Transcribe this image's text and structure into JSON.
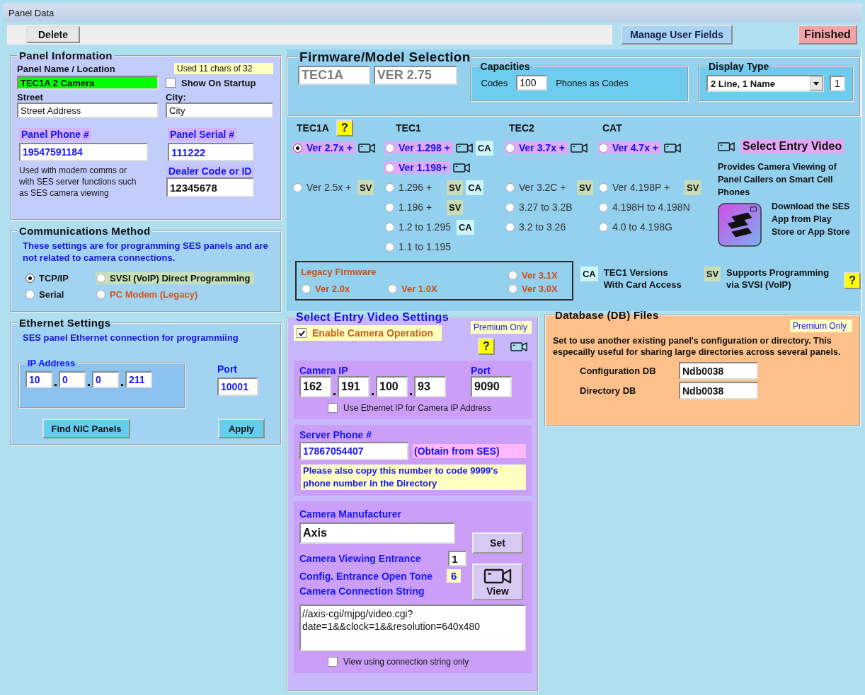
{
  "window": {
    "title": "Panel Data"
  },
  "toolbar": {
    "delete_button": "Delete",
    "manage_button": "Manage User Fields",
    "finished_button": "Finished"
  },
  "panel_info": {
    "title": "Panel Information",
    "name_label": "Panel Name / Location",
    "char_count": "Used 11 chars of 32",
    "name_value": "TEC1A 2 Camera",
    "show_on_startup": {
      "label": "Show On Startup",
      "checked": false
    },
    "street_label": "Street",
    "city_label": "City:",
    "street_value": "Street Address",
    "city_value": "City",
    "phone_label": "Panel Phone #",
    "serial_label": "Panel Serial #",
    "phone_value": "19547591184",
    "serial_value": "111222",
    "phone_note": "Used with modem comms or with SES server functions such as SES camera viewing",
    "dealer_label": "Dealer Code or ID",
    "dealer_value": "12345678"
  },
  "comms": {
    "title": "Communications Method",
    "note": "These settings are for programming SES panels and are not related to camera connections.",
    "options": [
      {
        "label": "TCP/IP",
        "selected": true,
        "kind": "plain"
      },
      {
        "label": "SVSI (VoIP) Direct Programming",
        "selected": false,
        "kind": "voip"
      },
      {
        "label": "Serial",
        "selected": false,
        "kind": "plain"
      },
      {
        "label": "PC Modem (Legacy)",
        "selected": false,
        "kind": "legacy"
      }
    ]
  },
  "ethernet": {
    "title": "Ethernet Settings",
    "note": "SES panel Ethernet connection for programmiing",
    "ip_title": "IP Address",
    "ip": [
      "10",
      "0",
      "0",
      "211"
    ],
    "port_label": "Port",
    "port": "10001",
    "find_button": "Find NIC Panels",
    "apply_button": "Apply"
  },
  "firmware": {
    "title": "Firmware/Model Selection",
    "model": "TEC1A",
    "version": "VER 2.75",
    "capacities": {
      "title": "Capacities",
      "codes_label": "Codes",
      "codes": "100",
      "phones_label": "Phones as Codes"
    },
    "display": {
      "title": "Display Type",
      "value": "2 Line, 1 Name",
      "lines": "1"
    },
    "headings": [
      {
        "label": "TEC1A",
        "help": "?"
      },
      {
        "label": "TEC1"
      },
      {
        "label": "TEC2"
      },
      {
        "label": "CAT"
      }
    ],
    "rows": [
      {
        "cells": [
          {
            "kind": "current",
            "label": "Ver 2.7x +",
            "selected": true,
            "camera": true
          },
          {
            "kind": "current",
            "label": "Ver 1.298 +",
            "selected": false,
            "camera": true,
            "tags": [
              {
                "kind": "ca",
                "text": "CA"
              }
            ]
          },
          {
            "kind": "current",
            "label": "Ver 3.7x +",
            "selected": false,
            "camera": true
          },
          {
            "kind": "current",
            "label": "Ver 4.7x +",
            "selected": false,
            "camera": true
          }
        ]
      },
      {
        "cells": [
          {
            "kind": "empty"
          },
          {
            "kind": "current",
            "label": "Ver 1.198+",
            "selected": false,
            "camera": true
          },
          {
            "kind": "empty"
          },
          {
            "kind": "empty"
          }
        ]
      },
      {
        "cells": [
          {
            "kind": "older",
            "label": "Ver 2.5x +",
            "selected": false,
            "tags": [
              {
                "kind": "sv",
                "text": "SV"
              }
            ]
          },
          {
            "kind": "older",
            "label": "1.296 +",
            "selected": false,
            "tags": [
              {
                "kind": "sv",
                "text": "SV"
              },
              {
                "kind": "ca",
                "text": "CA"
              }
            ]
          },
          {
            "kind": "older",
            "label": "Ver 3.2C +",
            "selected": false,
            "tags": [
              {
                "kind": "sv",
                "text": "SV"
              }
            ]
          },
          {
            "kind": "older",
            "label": "Ver 4.198P +",
            "selected": false,
            "tags": [
              {
                "kind": "sv",
                "text": "SV"
              }
            ]
          }
        ]
      },
      {
        "cells": [
          {
            "kind": "empty"
          },
          {
            "kind": "older",
            "label": "1.196 +",
            "selected": false,
            "tags": [
              {
                "kind": "sv",
                "text": "SV"
              }
            ]
          },
          {
            "kind": "older",
            "label": "3.27 to 3.2B",
            "selected": false
          },
          {
            "kind": "older",
            "label": "4.198H to 4.198N",
            "selected": false
          }
        ]
      },
      {
        "cells": [
          {
            "kind": "empty"
          },
          {
            "kind": "older",
            "label": "1.2 to 1.295",
            "selected": false,
            "tags": [
              {
                "kind": "ca",
                "text": "CA"
              }
            ]
          },
          {
            "kind": "older",
            "label": "3.2 to 3.26",
            "selected": false
          },
          {
            "kind": "older",
            "label": "4.0 to 4.198G",
            "selected": false
          }
        ]
      },
      {
        "cells": [
          {
            "kind": "empty"
          },
          {
            "kind": "older",
            "label": "1.1 to 1.195",
            "selected": false
          },
          {
            "kind": "empty"
          },
          {
            "kind": "empty"
          }
        ]
      }
    ],
    "promo": {
      "title": "Select Entry Video",
      "text": "Provides Camera Viewing of Panel Callers on Smart Cell Phones",
      "download": "Download the SES App from Play Store or App Store"
    },
    "legacy": {
      "title": "Legacy Firmware",
      "columns": [
        [
          {
            "label": "Ver 2.0x",
            "selected": false
          }
        ],
        [
          {
            "label": "Ver 1.0X",
            "selected": false
          }
        ],
        [
          {
            "label": "Ver 3.1X",
            "selected": false
          },
          {
            "label": "Ver 3.0X",
            "selected": false
          }
        ]
      ]
    },
    "legend": [
      {
        "kind": "ca",
        "tag": "CA",
        "text": "TEC1 Versions With Card Access"
      },
      {
        "kind": "sv",
        "tag": "SV",
        "text": "Supports Programming via SVSI (VoIP)"
      }
    ],
    "legend_help": "?"
  },
  "video": {
    "title": "Select Entry Video Settings",
    "premium": "Premium Only",
    "enable": {
      "label": "Enable Camera Operation",
      "checked": true
    },
    "help": "?",
    "camera_ip_label": "Camera IP",
    "camera_ip": [
      "162",
      "191",
      "100",
      "93"
    ],
    "port_label": "Port",
    "port": "9090",
    "use_ethernet": {
      "label": "Use Ethernet IP for Camera IP Address",
      "checked": false
    },
    "server_label": "Server Phone #",
    "server_value": "17867054407",
    "server_hint": "(Obtain from SES)",
    "server_note": "Please also copy this number to code 9999's phone number in the Directory",
    "manufacturer_label": "Camera Manufacturer",
    "manufacturer": "Axis",
    "set_button": "Set",
    "entrance_label": "Camera Viewing Entrance",
    "entrance": "1",
    "tone_label": "Config. Entrance Open Tone",
    "tone": "6",
    "view_button": "View",
    "connection_label": "Camera Connection String",
    "connection_lines": [
      "//axis-cgi/mjpg/video.cgi?",
      "date=1&&clock=1&&resolution=640x480"
    ],
    "string_only": {
      "label": "View using connection string only",
      "checked": false
    }
  },
  "database": {
    "title": "Database (DB) Files",
    "premium": "Premium Only",
    "note": "Set to use another existing panel's configuration or directory. This especailly useful for sharing large directories across several panels.",
    "config_label": "Configuration DB",
    "config_value": "Ndb0038",
    "directory_label": "Directory DB",
    "directory_value": "Ndb0038"
  }
}
